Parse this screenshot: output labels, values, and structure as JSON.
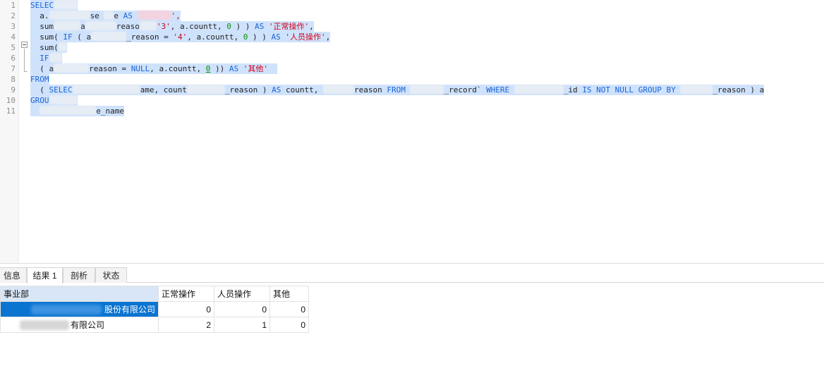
{
  "editor": {
    "line_numbers": [
      "1",
      "2",
      "3",
      "4",
      "5",
      "6",
      "7",
      "8",
      "9",
      "10",
      "11"
    ],
    "lines": {
      "l1": {
        "kw": "SELEC"
      },
      "l2": {
        "a": "a.",
        "b": "se",
        "c": "e",
        "kw": "AS",
        "tail": "',"
      },
      "l3": {
        "a": "sum",
        "b": "a",
        "c": "reaso",
        "str": "'3'",
        "d": ", a.countt,",
        "num": "0",
        "e": ") )",
        "kw": "AS",
        "alias": "'正常操作'",
        "tail": ","
      },
      "l4": {
        "a": "sum(",
        "kw1": "IF",
        "b": "( a",
        "c": "_reason = ",
        "str": "'4'",
        "d": ", a.countt,",
        "num": "0",
        "e": ") )",
        "kw": "AS",
        "alias": "'人员操作'",
        "tail": ","
      },
      "l5": {
        "a": "sum("
      },
      "l6": {
        "kw": "IF"
      },
      "l7": {
        "a": "( a",
        "b": "reason = ",
        "kw": "NULL",
        "c": ", a.countt,",
        "num": "0",
        "d": "))",
        "kw2": "AS",
        "alias": "'其他'"
      },
      "l8": {
        "kw": "FROM"
      },
      "l9": {
        "a": "( ",
        "kw1": "SELEC",
        "b": "ame, count",
        "c": "_reason )",
        "kw2": "AS",
        "d": "countt,",
        "e": "reason",
        "kw3": "FROM",
        "f": "_record`",
        "kw4": "WHERE",
        "g": "_id",
        "kw5": "IS NOT NULL GROUP BY",
        "h": "_reason ) a"
      },
      "l10": {
        "kw": "GROU"
      },
      "l11": {
        "a": "e_name"
      }
    }
  },
  "results": {
    "tabs": [
      "信息",
      "结果 1",
      "剖析",
      "状态"
    ],
    "active_tab": "结果 1",
    "columns": [
      "事业部",
      "正常操作",
      "人员操作",
      "其他"
    ],
    "rows": [
      {
        "name": "股份有限公司",
        "normal": "0",
        "staff": "0",
        "other": "0",
        "selected": true
      },
      {
        "name": "有限公司",
        "normal": "2",
        "staff": "1",
        "other": "0",
        "selected": false
      }
    ]
  },
  "colors": {
    "keyword": "#1a64d6",
    "number": "#0a8f0a",
    "string": "#d0021b",
    "selection": "#cfe2fb",
    "selected_cell": "#0a74d1"
  }
}
